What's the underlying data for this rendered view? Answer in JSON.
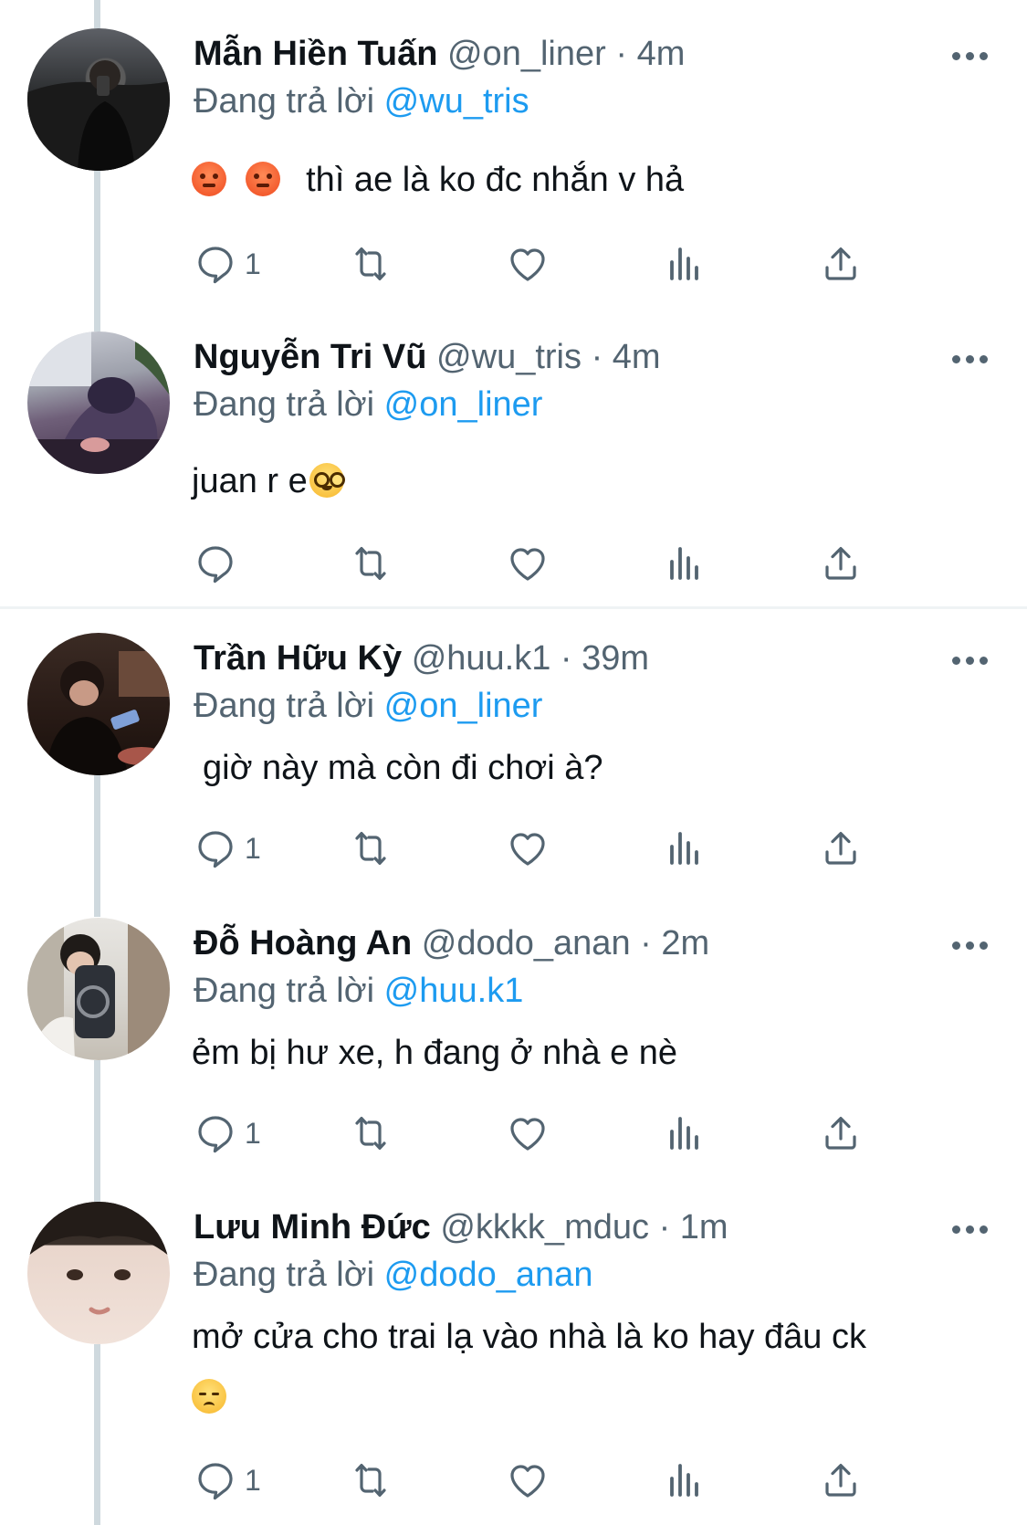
{
  "colors": {
    "link": "#1d9bf0",
    "secondary_text": "#536471",
    "thread_line": "#cfd9de"
  },
  "reply_prefix": "Đang trả lời",
  "tweets": [
    {
      "name": "Mẫn Hiền Tuấn",
      "handle": "@on_liner",
      "sep": "·",
      "time": "4m",
      "reply_to": "@wu_tris",
      "emojis_before": [
        "angry-face",
        "angry-face"
      ],
      "text": "thì ae là ko đc nhắn v hả",
      "reply_count": "1"
    },
    {
      "name": "Nguyễn Tri Vũ",
      "handle": "@wu_tris",
      "sep": "·",
      "time": "4m",
      "reply_to": "@on_liner",
      "text": "juan r e",
      "emojis_after": [
        "nerd-face"
      ],
      "reply_count": ""
    },
    {
      "name": "Trần Hữu Kỳ",
      "handle": "@huu.k1",
      "sep": "·",
      "time": "39m",
      "reply_to": "@on_liner",
      "text": "giờ này mà còn đi chơi à?",
      "reply_count": "1"
    },
    {
      "name": "Đỗ Hoàng An",
      "handle": "@dodo_anan",
      "sep": "·",
      "time": "2m",
      "reply_to": "@huu.k1",
      "text": "ẻm bị hư xe, h đang ở nhà e nè",
      "reply_count": "1"
    },
    {
      "name": "Lưu Minh Đức",
      "handle": "@kkkk_mduc",
      "sep": "·",
      "time": "1m",
      "reply_to": "@dodo_anan",
      "text": "mở cửa cho trai lạ vào nhà là ko hay đâu ck",
      "emojis_line2": [
        "disappointed-face"
      ],
      "reply_count": "1"
    }
  ]
}
